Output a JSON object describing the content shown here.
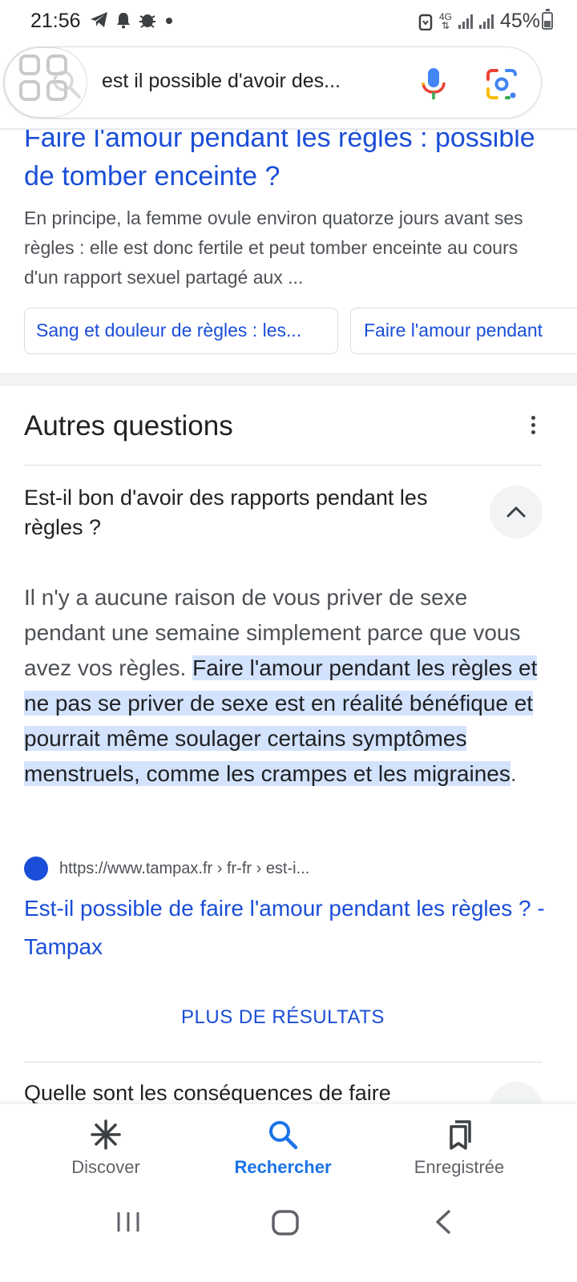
{
  "status_bar": {
    "time": "21:56",
    "network": "4G",
    "battery": "45%",
    "battery_level": 0.45,
    "icons": [
      "telegram-icon",
      "notification-bell-icon",
      "bug-icon",
      "dot-icon",
      "battery-saver-icon",
      "signal-icon",
      "battery-icon"
    ]
  },
  "search": {
    "query": "est il possible d'avoir des...",
    "icons": [
      "apps-grid-icon",
      "search-icon",
      "mic-icon",
      "google-lens-icon"
    ]
  },
  "top_result": {
    "title": "Faire l'amour pendant les règles : possible de tomber enceinte ?",
    "snippet": "En principe, la femme ovule environ quatorze jours avant ses règles : elle est donc fertile et peut tomber enceinte au cours d'un rapport sexuel partagé aux ...",
    "chips": [
      "Sang et douleur de règles : les...",
      "Faire l'amour pendant"
    ]
  },
  "related_questions": {
    "title": "Autres questions",
    "q1": {
      "question": "Est-il bon d'avoir des rapports pendant les règles ?",
      "answer_plain": "Il n'y a aucune raison de vous priver de sexe pendant une semaine simplement parce que vous avez vos règles. ",
      "answer_highlight": "Faire l'amour pendant les règles et ne pas se priver de sexe est en réalité bénéfique et pourrait même soulager certains symptômes menstruels, comme les crampes et les migraines",
      "answer_end": ".",
      "source_url": "https://www.tampax.fr › fr-fr › est-i...",
      "source_title": "Est-il possible de faire l'amour pendant les règles ? - Tampax"
    },
    "more_results": "PLUS DE RÉSULTATS",
    "q2": {
      "question": "Quelle sont les conséquences de faire"
    }
  },
  "bottom_nav": {
    "discover": "Discover",
    "search": "Rechercher",
    "saved": "Enregistrée",
    "active": "search"
  },
  "colors": {
    "link": "#1a4ed8",
    "highlight": "#d3e3fd",
    "active_nav": "#1a73e8"
  }
}
